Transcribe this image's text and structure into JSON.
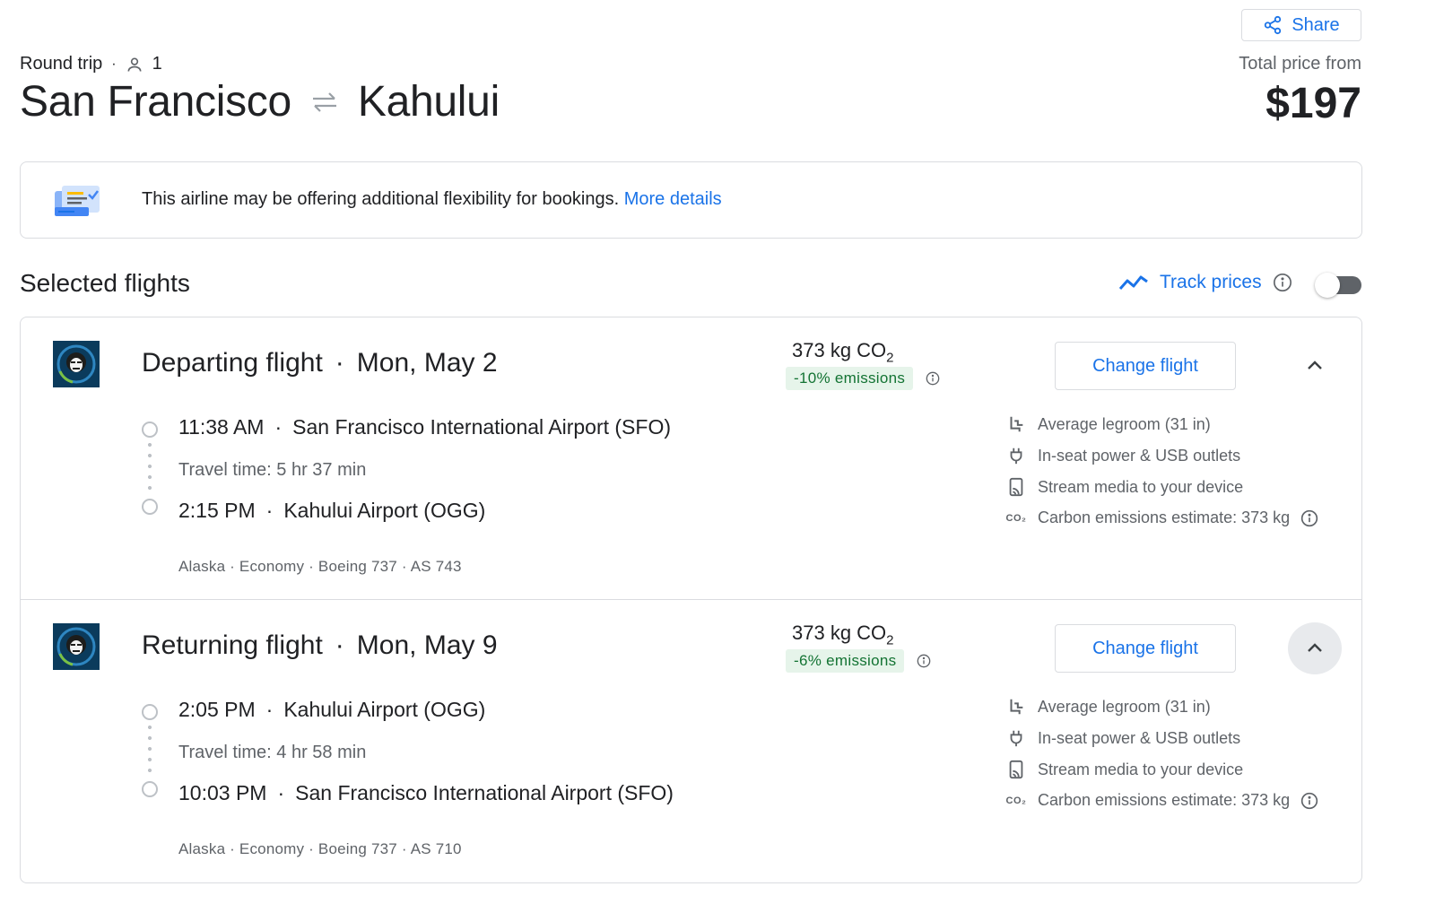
{
  "header": {
    "share_label": "Share",
    "trip_type": "Round trip",
    "passengers": "1",
    "origin": "San Francisco",
    "destination": "Kahului",
    "total_label": "Total price from",
    "total_price": "$197"
  },
  "banner": {
    "text": "This airline may be offering additional flexibility for bookings.",
    "link": "More details"
  },
  "selected": {
    "title": "Selected flights",
    "track_label": "Track prices",
    "track_enabled": false
  },
  "flights": [
    {
      "title": "Departing flight",
      "date": "Mon, May 2",
      "co2_value": "373 kg CO",
      "co2_sub": "2",
      "emissions": "-10% emissions",
      "change_label": "Change flight",
      "depart_time": "11:38 AM",
      "depart_airport": "San Francisco International Airport (SFO)",
      "travel_time": "Travel time: 5 hr 37 min",
      "arrive_time": "2:15 PM",
      "arrive_airport": "Kahului Airport (OGG)",
      "details": "Alaska · Economy · Boeing 737 · AS 743",
      "amenities": [
        {
          "icon": "legroom-icon",
          "text": "Average legroom (31 in)"
        },
        {
          "icon": "power-icon",
          "text": "In-seat power & USB outlets"
        },
        {
          "icon": "stream-icon",
          "text": "Stream media to your device"
        },
        {
          "icon": "co2-icon",
          "text": "Carbon emissions estimate: 373 kg"
        }
      ]
    },
    {
      "title": "Returning flight",
      "date": "Mon, May 9",
      "co2_value": "373 kg CO",
      "co2_sub": "2",
      "emissions": "-6% emissions",
      "change_label": "Change flight",
      "depart_time": "2:05 PM",
      "depart_airport": "Kahului Airport (OGG)",
      "travel_time": "Travel time: 4 hr 58 min",
      "arrive_time": "10:03 PM",
      "arrive_airport": "San Francisco International Airport (SFO)",
      "details": "Alaska · Economy · Boeing 737 · AS 710",
      "amenities": [
        {
          "icon": "legroom-icon",
          "text": "Average legroom (31 in)"
        },
        {
          "icon": "power-icon",
          "text": "In-seat power & USB outlets"
        },
        {
          "icon": "stream-icon",
          "text": "Stream media to your device"
        },
        {
          "icon": "co2-icon",
          "text": "Carbon emissions estimate: 373 kg"
        }
      ]
    }
  ],
  "co2_icon_text": "CO₂",
  "colors": {
    "accent": "#1a73e8",
    "emissions_bg": "#e6f4ea",
    "emissions_text": "#137333",
    "border": "#dadce0",
    "secondary_text": "#5f6368"
  }
}
